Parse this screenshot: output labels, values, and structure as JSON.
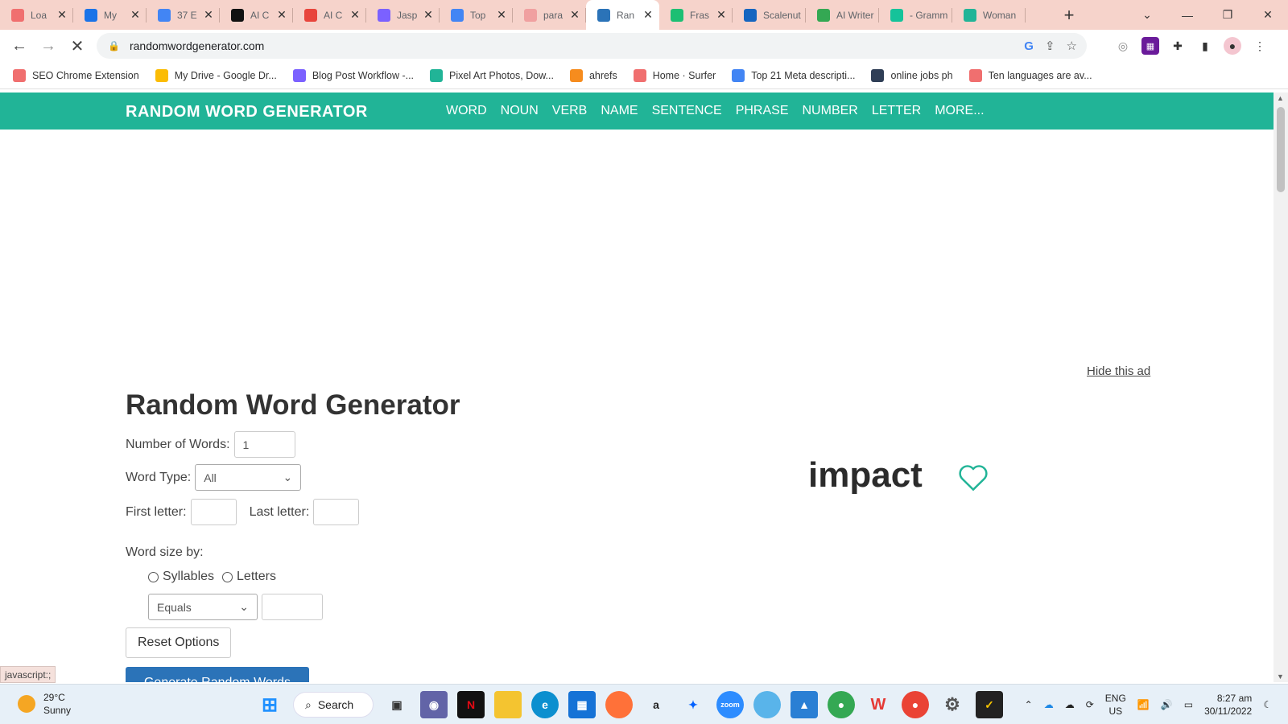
{
  "browser": {
    "tabs": [
      {
        "title": "Loa",
        "color": "#f06f6f"
      },
      {
        "title": "My",
        "color": "#1a73e8"
      },
      {
        "title": "37 E",
        "color": "#4285f4"
      },
      {
        "title": "AI C",
        "color": "#111111"
      },
      {
        "title": "AI C",
        "color": "#e8453c"
      },
      {
        "title": "Jasp",
        "color": "#7b61ff"
      },
      {
        "title": "Top",
        "color": "#4285f4"
      },
      {
        "title": "para",
        "color": "#f0a0a0"
      },
      {
        "title": "Ran",
        "color": "#2b73b8"
      },
      {
        "title": "Fras",
        "color": "#1dbf73"
      },
      {
        "title": "Scalenut",
        "color": "#1565c0"
      },
      {
        "title": "AI Writer",
        "color": "#34a853"
      },
      {
        "title": "- Gramm",
        "color": "#15c39a"
      },
      {
        "title": "Woman",
        "color": "#21b497"
      }
    ],
    "url": "randomwordgenerator.com",
    "bookmarks": [
      {
        "label": "SEO Chrome Extension",
        "color": "#f06f6f"
      },
      {
        "label": "My Drive - Google Dr...",
        "color": "#fbbc04"
      },
      {
        "label": "Blog Post Workflow -...",
        "color": "#7b61ff"
      },
      {
        "label": "Pixel Art Photos, Dow...",
        "color": "#21b497"
      },
      {
        "label": "ahrefs",
        "color": "#f68c1e"
      },
      {
        "label": "Home · Surfer",
        "color": "#f06f6f"
      },
      {
        "label": "Top 21 Meta descripti...",
        "color": "#4285f4"
      },
      {
        "label": "online jobs ph",
        "color": "#2f3e56"
      },
      {
        "label": "Ten languages are av...",
        "color": "#f06f6f"
      }
    ],
    "status_tip": "javascript:;"
  },
  "site": {
    "brand": "RANDOM WORD GENERATOR",
    "nav": [
      "WORD",
      "NOUN",
      "VERB",
      "NAME",
      "SENTENCE",
      "PHRASE",
      "NUMBER",
      "LETTER",
      "MORE..."
    ],
    "accent": "#21b497",
    "hide_ad": "Hide this ad",
    "title": "Random Word Generator",
    "form": {
      "num_words_label": "Number of Words:",
      "num_words_value": "1",
      "word_type_label": "Word Type:",
      "word_type_value": "All",
      "first_letter_label": "First letter:",
      "last_letter_label": "Last letter:",
      "word_size_label": "Word size by:",
      "syllables_label": "Syllables",
      "letters_label": "Letters",
      "size_compare_value": "Equals",
      "reset_label": "Reset Options",
      "generate_label": "Generate Random Words"
    },
    "result_word": "impact"
  },
  "taskbar": {
    "temp": "29°C",
    "condition": "Sunny",
    "search_label": "Search",
    "lang": "ENG",
    "region": "US",
    "time": "8:27 am",
    "date": "30/11/2022"
  }
}
